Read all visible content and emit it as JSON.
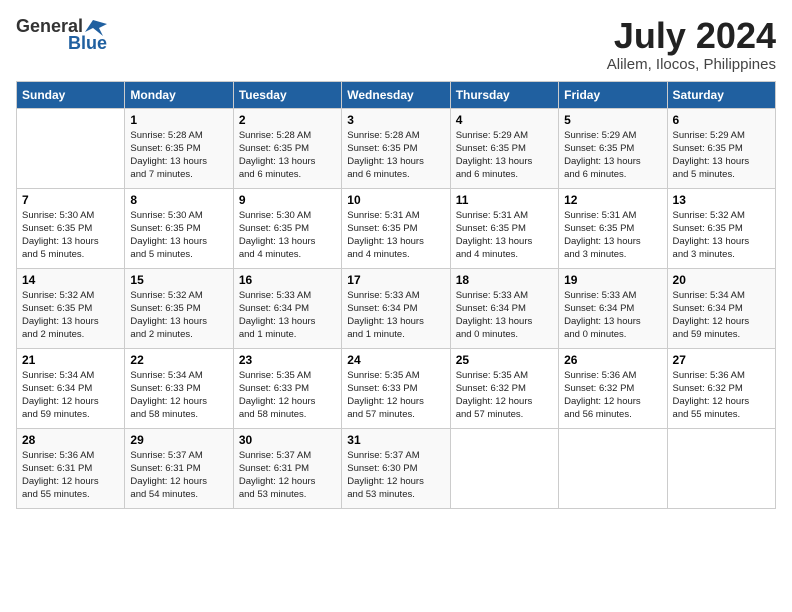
{
  "logo": {
    "text_general": "General",
    "text_blue": "Blue"
  },
  "title": {
    "month_year": "July 2024",
    "location": "Alilem, Ilocos, Philippines"
  },
  "calendar": {
    "headers": [
      "Sunday",
      "Monday",
      "Tuesday",
      "Wednesday",
      "Thursday",
      "Friday",
      "Saturday"
    ],
    "weeks": [
      [
        {
          "day": "",
          "content": ""
        },
        {
          "day": "1",
          "content": "Sunrise: 5:28 AM\nSunset: 6:35 PM\nDaylight: 13 hours\nand 7 minutes."
        },
        {
          "day": "2",
          "content": "Sunrise: 5:28 AM\nSunset: 6:35 PM\nDaylight: 13 hours\nand 6 minutes."
        },
        {
          "day": "3",
          "content": "Sunrise: 5:28 AM\nSunset: 6:35 PM\nDaylight: 13 hours\nand 6 minutes."
        },
        {
          "day": "4",
          "content": "Sunrise: 5:29 AM\nSunset: 6:35 PM\nDaylight: 13 hours\nand 6 minutes."
        },
        {
          "day": "5",
          "content": "Sunrise: 5:29 AM\nSunset: 6:35 PM\nDaylight: 13 hours\nand 6 minutes."
        },
        {
          "day": "6",
          "content": "Sunrise: 5:29 AM\nSunset: 6:35 PM\nDaylight: 13 hours\nand 5 minutes."
        }
      ],
      [
        {
          "day": "7",
          "content": "Sunrise: 5:30 AM\nSunset: 6:35 PM\nDaylight: 13 hours\nand 5 minutes."
        },
        {
          "day": "8",
          "content": "Sunrise: 5:30 AM\nSunset: 6:35 PM\nDaylight: 13 hours\nand 5 minutes."
        },
        {
          "day": "9",
          "content": "Sunrise: 5:30 AM\nSunset: 6:35 PM\nDaylight: 13 hours\nand 4 minutes."
        },
        {
          "day": "10",
          "content": "Sunrise: 5:31 AM\nSunset: 6:35 PM\nDaylight: 13 hours\nand 4 minutes."
        },
        {
          "day": "11",
          "content": "Sunrise: 5:31 AM\nSunset: 6:35 PM\nDaylight: 13 hours\nand 4 minutes."
        },
        {
          "day": "12",
          "content": "Sunrise: 5:31 AM\nSunset: 6:35 PM\nDaylight: 13 hours\nand 3 minutes."
        },
        {
          "day": "13",
          "content": "Sunrise: 5:32 AM\nSunset: 6:35 PM\nDaylight: 13 hours\nand 3 minutes."
        }
      ],
      [
        {
          "day": "14",
          "content": "Sunrise: 5:32 AM\nSunset: 6:35 PM\nDaylight: 13 hours\nand 2 minutes."
        },
        {
          "day": "15",
          "content": "Sunrise: 5:32 AM\nSunset: 6:35 PM\nDaylight: 13 hours\nand 2 minutes."
        },
        {
          "day": "16",
          "content": "Sunrise: 5:33 AM\nSunset: 6:34 PM\nDaylight: 13 hours\nand 1 minute."
        },
        {
          "day": "17",
          "content": "Sunrise: 5:33 AM\nSunset: 6:34 PM\nDaylight: 13 hours\nand 1 minute."
        },
        {
          "day": "18",
          "content": "Sunrise: 5:33 AM\nSunset: 6:34 PM\nDaylight: 13 hours\nand 0 minutes."
        },
        {
          "day": "19",
          "content": "Sunrise: 5:33 AM\nSunset: 6:34 PM\nDaylight: 13 hours\nand 0 minutes."
        },
        {
          "day": "20",
          "content": "Sunrise: 5:34 AM\nSunset: 6:34 PM\nDaylight: 12 hours\nand 59 minutes."
        }
      ],
      [
        {
          "day": "21",
          "content": "Sunrise: 5:34 AM\nSunset: 6:34 PM\nDaylight: 12 hours\nand 59 minutes."
        },
        {
          "day": "22",
          "content": "Sunrise: 5:34 AM\nSunset: 6:33 PM\nDaylight: 12 hours\nand 58 minutes."
        },
        {
          "day": "23",
          "content": "Sunrise: 5:35 AM\nSunset: 6:33 PM\nDaylight: 12 hours\nand 58 minutes."
        },
        {
          "day": "24",
          "content": "Sunrise: 5:35 AM\nSunset: 6:33 PM\nDaylight: 12 hours\nand 57 minutes."
        },
        {
          "day": "25",
          "content": "Sunrise: 5:35 AM\nSunset: 6:32 PM\nDaylight: 12 hours\nand 57 minutes."
        },
        {
          "day": "26",
          "content": "Sunrise: 5:36 AM\nSunset: 6:32 PM\nDaylight: 12 hours\nand 56 minutes."
        },
        {
          "day": "27",
          "content": "Sunrise: 5:36 AM\nSunset: 6:32 PM\nDaylight: 12 hours\nand 55 minutes."
        }
      ],
      [
        {
          "day": "28",
          "content": "Sunrise: 5:36 AM\nSunset: 6:31 PM\nDaylight: 12 hours\nand 55 minutes."
        },
        {
          "day": "29",
          "content": "Sunrise: 5:37 AM\nSunset: 6:31 PM\nDaylight: 12 hours\nand 54 minutes."
        },
        {
          "day": "30",
          "content": "Sunrise: 5:37 AM\nSunset: 6:31 PM\nDaylight: 12 hours\nand 53 minutes."
        },
        {
          "day": "31",
          "content": "Sunrise: 5:37 AM\nSunset: 6:30 PM\nDaylight: 12 hours\nand 53 minutes."
        },
        {
          "day": "",
          "content": ""
        },
        {
          "day": "",
          "content": ""
        },
        {
          "day": "",
          "content": ""
        }
      ]
    ]
  }
}
